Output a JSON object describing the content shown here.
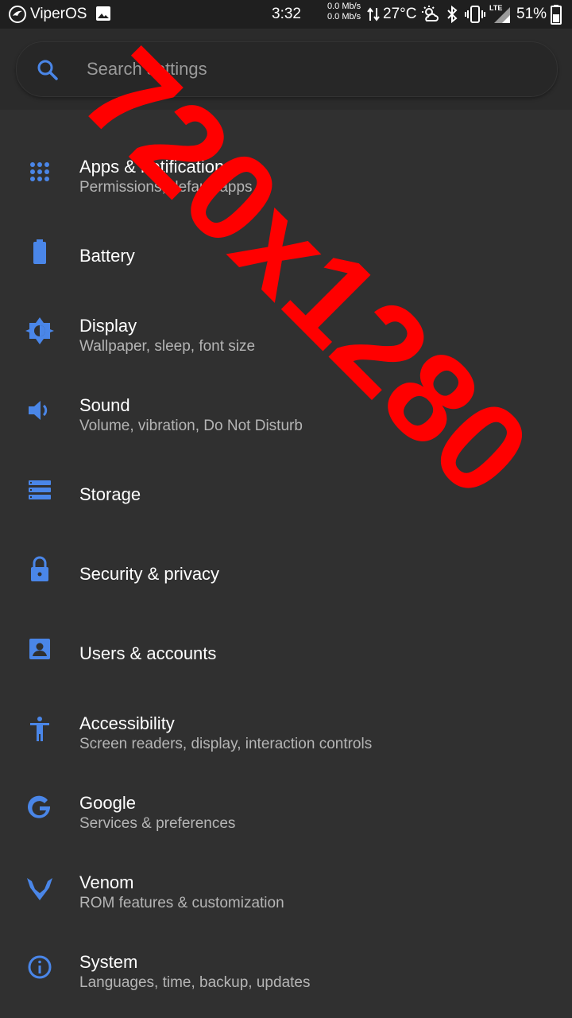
{
  "status_bar": {
    "carrier": "ViperOS",
    "time": "3:32",
    "net_up": "0.0 Mb/s",
    "net_down": "0.0 Mb/s",
    "temperature": "27°C",
    "network_type": "LTE",
    "battery_percent": "51%"
  },
  "search": {
    "placeholder": "Search settings"
  },
  "settings": [
    {
      "title": "Apps & notifications",
      "subtitle": "Permissions, default apps",
      "icon": "apps-grid-icon"
    },
    {
      "title": "Battery",
      "subtitle": "",
      "icon": "battery-icon"
    },
    {
      "title": "Display",
      "subtitle": "Wallpaper, sleep, font size",
      "icon": "brightness-icon"
    },
    {
      "title": "Sound",
      "subtitle": "Volume, vibration, Do Not Disturb",
      "icon": "volume-icon"
    },
    {
      "title": "Storage",
      "subtitle": "",
      "icon": "storage-icon"
    },
    {
      "title": "Security & privacy",
      "subtitle": "",
      "icon": "lock-icon"
    },
    {
      "title": "Users & accounts",
      "subtitle": "",
      "icon": "account-box-icon"
    },
    {
      "title": "Accessibility",
      "subtitle": "Screen readers, display, interaction controls",
      "icon": "accessibility-icon"
    },
    {
      "title": "Google",
      "subtitle": "Services & preferences",
      "icon": "google-icon"
    },
    {
      "title": "Venom",
      "subtitle": "ROM features & customization",
      "icon": "venom-icon"
    },
    {
      "title": "System",
      "subtitle": "Languages, time, backup, updates",
      "icon": "info-icon"
    }
  ],
  "watermark": {
    "text": "720x1280",
    "color": "#ff0000"
  },
  "colors": {
    "accent": "#4a86e8",
    "background": "#303030",
    "status_bar": "#1f1f1f"
  }
}
